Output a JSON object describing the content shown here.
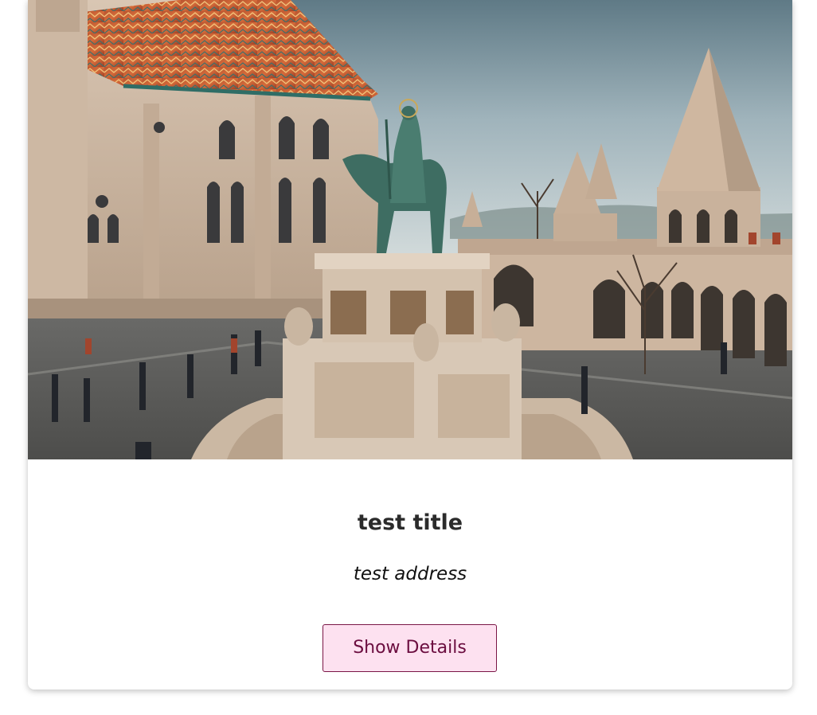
{
  "card": {
    "title": "test title",
    "address": "test address",
    "button_label": "Show Details"
  },
  "colors": {
    "button_background": "#fde1f0",
    "button_border": "#7a1646",
    "button_text": "#6b0d3f",
    "title_text": "#2b2b2b"
  }
}
